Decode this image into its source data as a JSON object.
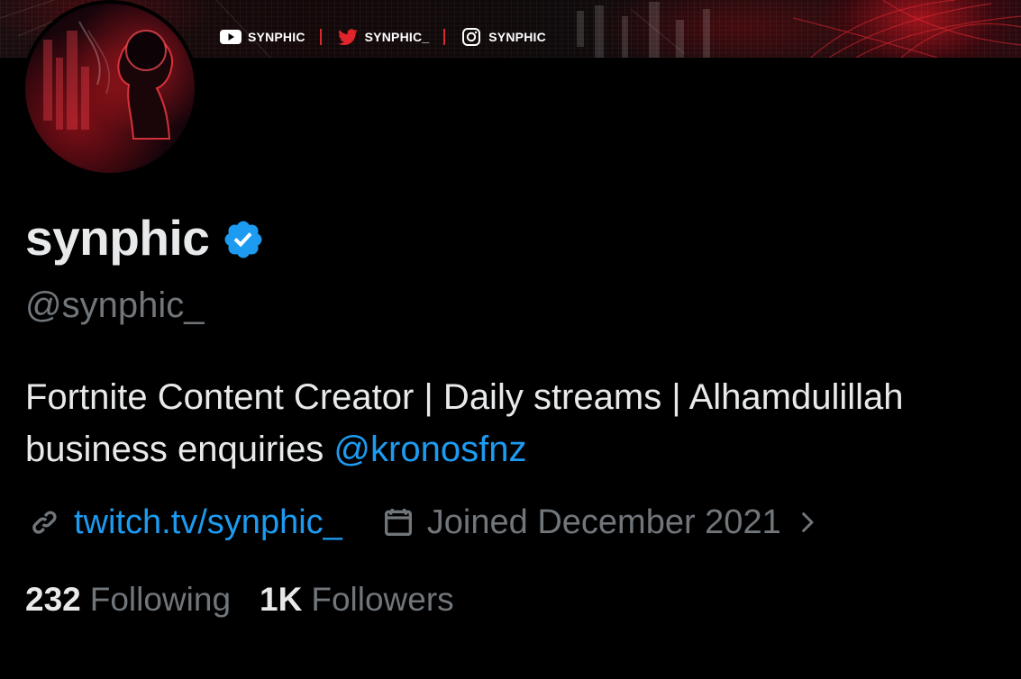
{
  "banner": {
    "social_links": [
      {
        "platform_icon": "youtube-icon",
        "label": "SYNPHIC"
      },
      {
        "platform_icon": "twitter-icon",
        "label": "SYNPHIC_"
      },
      {
        "platform_icon": "instagram-icon",
        "label": "SYNPHIC"
      }
    ]
  },
  "profile": {
    "display_name": "synphic",
    "verified": true,
    "handle": "@synphic_",
    "bio_line1": "Fortnite Content Creator | Daily streams | Alhamdulillah",
    "bio_line2_prefix": "business enquiries ",
    "bio_mention": "@kronosfnz",
    "website": "twitch.tv/synphic_",
    "joined": "Joined December 2021",
    "following_count": "232",
    "following_label": "Following",
    "followers_count": "1K",
    "followers_label": "Followers"
  },
  "colors": {
    "background": "#000000",
    "primary_text": "#e7e9ea",
    "secondary_text": "#71767b",
    "link": "#1d9bf0",
    "verified_badge": "#1d9bf0",
    "banner_accent": "#d42a2a"
  }
}
